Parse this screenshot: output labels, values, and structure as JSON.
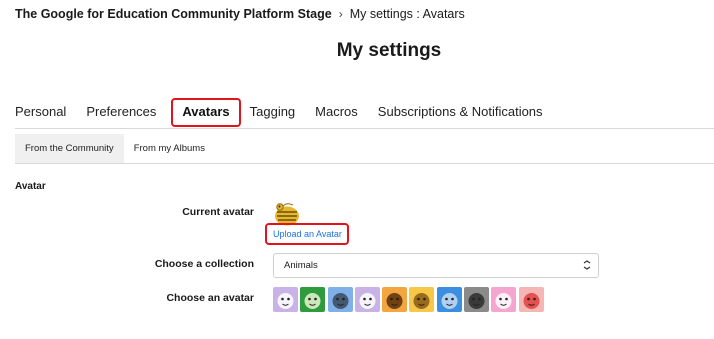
{
  "breadcrumb": {
    "root": "The Google for Education Community Platform Stage",
    "separator": "›",
    "current": "My settings : Avatars"
  },
  "page_title": "My settings",
  "tabs": [
    {
      "label": "Personal",
      "active": false
    },
    {
      "label": "Preferences",
      "active": false
    },
    {
      "label": "Avatars",
      "active": true
    },
    {
      "label": "Tagging",
      "active": false
    },
    {
      "label": "Macros",
      "active": false
    },
    {
      "label": "Subscriptions & Notifications",
      "active": false
    }
  ],
  "subtabs": [
    {
      "label": "From the Community",
      "active": true
    },
    {
      "label": "From my Albums",
      "active": false
    }
  ],
  "section": {
    "title": "Avatar",
    "current_avatar_label": "Current avatar",
    "upload_link": "Upload an Avatar",
    "collection_label": "Choose a collection",
    "collection_value": "Animals",
    "choose_label": "Choose an avatar"
  },
  "avatars": [
    {
      "name": "dog-avatar",
      "bg": "#c9b3e6",
      "fg": "#ffffff"
    },
    {
      "name": "frog-avatar",
      "bg": "#2e9b3f",
      "fg": "#e8f5d0"
    },
    {
      "name": "bulldog-avatar",
      "bg": "#7fb0e8",
      "fg": "#3a4a5c"
    },
    {
      "name": "goat-avatar",
      "bg": "#c9b3e6",
      "fg": "#ffffff"
    },
    {
      "name": "tiger-avatar",
      "bg": "#f3a640",
      "fg": "#5a2f08"
    },
    {
      "name": "giraffe-avatar",
      "bg": "#f6c84a",
      "fg": "#8a5a12"
    },
    {
      "name": "hippo-avatar",
      "bg": "#3b8fe0",
      "fg": "#c7dcf5"
    },
    {
      "name": "gorilla-avatar",
      "bg": "#8a8a8a",
      "fg": "#2b2b2b"
    },
    {
      "name": "pig-avatar",
      "bg": "#f4a6cf",
      "fg": "#ffffff"
    },
    {
      "name": "rabbit-avatar",
      "bg": "#f5b6b6",
      "fg": "#e04040"
    }
  ],
  "colors": {
    "highlight": "#e3131b",
    "link": "#1a73e8"
  }
}
